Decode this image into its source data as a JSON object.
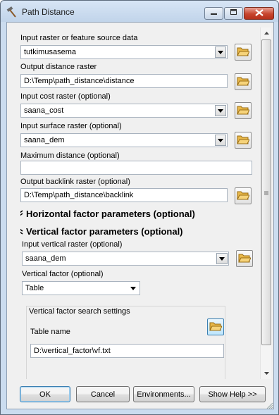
{
  "window": {
    "title": "Path Distance",
    "icons": {
      "app": "hammer-icon",
      "minimize": "minimize-icon",
      "maximize": "maximize-icon",
      "close": "close-icon"
    }
  },
  "form": {
    "input_raster": {
      "label": "Input raster or feature source data",
      "value": "tutkimusasema"
    },
    "output_distance": {
      "label": "Output distance raster",
      "value": "D:\\Temp\\path_distance\\distance"
    },
    "cost_raster": {
      "label": "Input cost raster (optional)",
      "value": "saana_cost"
    },
    "surface_raster": {
      "label": "Input surface raster (optional)",
      "value": "saana_dem"
    },
    "max_distance": {
      "label": "Maximum distance (optional)",
      "value": ""
    },
    "backlink": {
      "label": "Output backlink raster (optional)",
      "value": "D:\\Temp\\path_distance\\backlink"
    },
    "horizontal_section": {
      "label": "Horizontal factor parameters (optional)",
      "state": "collapsed"
    },
    "vertical_section": {
      "label": "Vertical factor parameters (optional)",
      "state": "expanded"
    },
    "vertical_raster": {
      "label": "Input vertical raster (optional)",
      "value": "saana_dem"
    },
    "vertical_factor": {
      "label": "Vertical factor (optional)",
      "value": "Table"
    },
    "search_settings": {
      "title": "Vertical factor search settings",
      "table_label": "Table name",
      "table_value": "D:\\vertical_factor\\vf.txt"
    }
  },
  "buttons": {
    "ok": "OK",
    "cancel": "Cancel",
    "environments": "Environments...",
    "show_help": "Show Help >>"
  },
  "colors": {
    "accent": "#3c7fb1",
    "folder": "#e8b84a",
    "close": "#c7452e"
  }
}
